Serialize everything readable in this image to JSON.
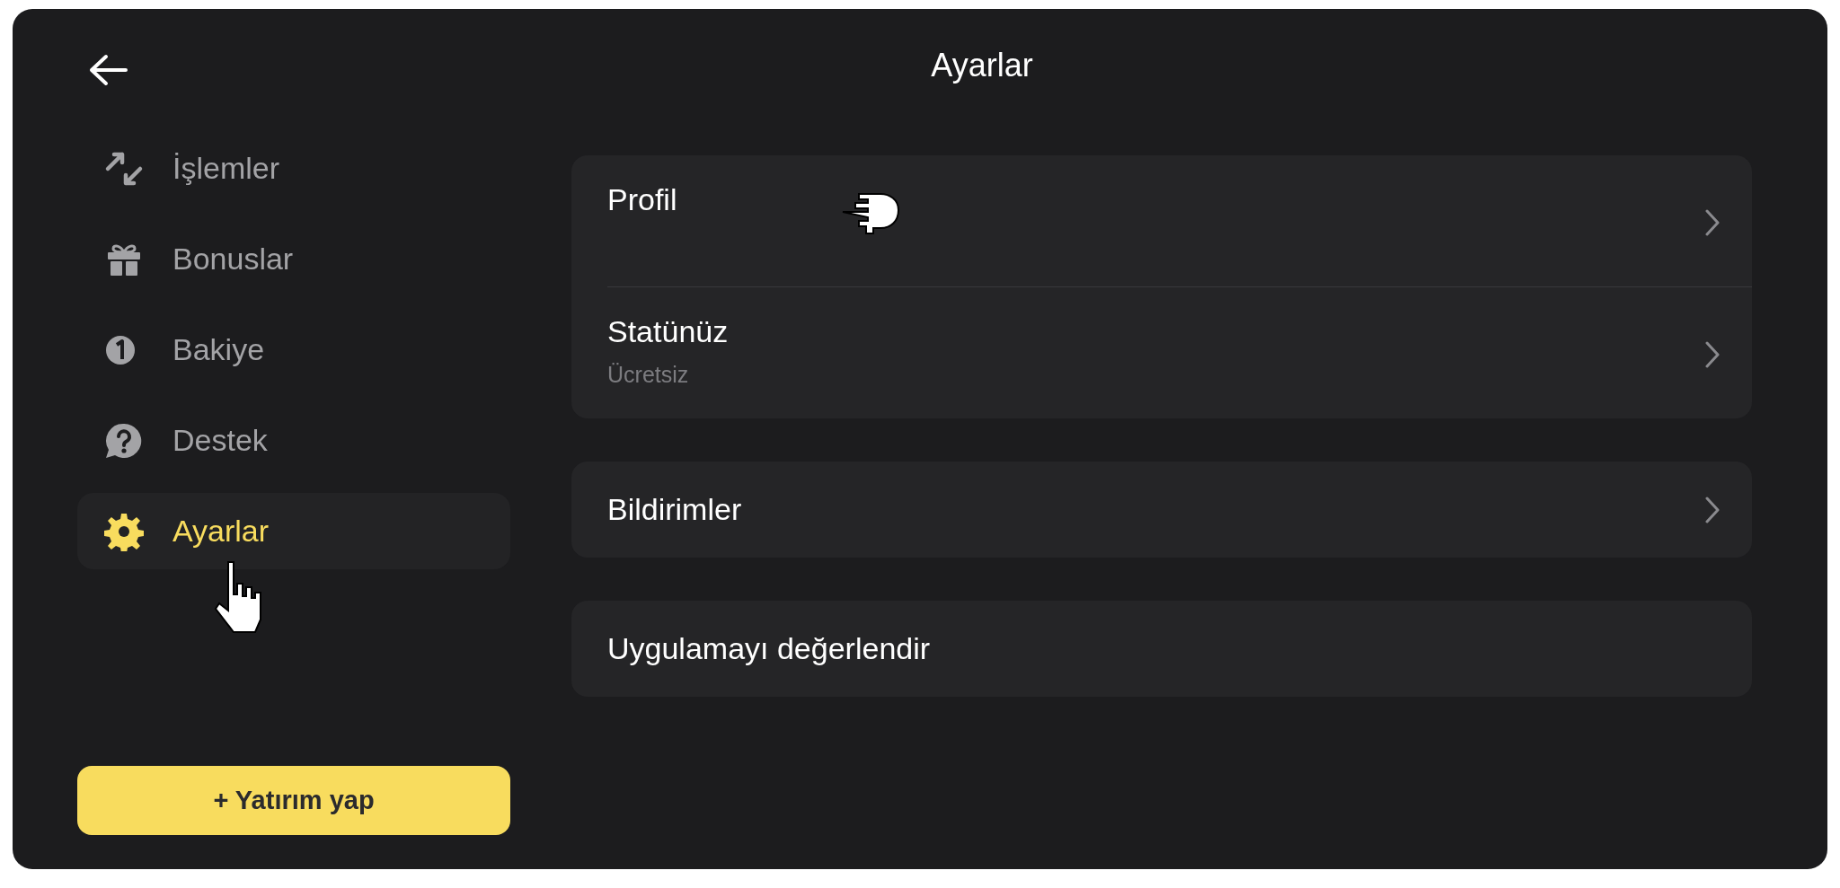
{
  "header": {
    "title": "Ayarlar"
  },
  "sidebar": {
    "items": [
      {
        "label": "İşlemler",
        "selected": false
      },
      {
        "label": "Bonuslar",
        "selected": false
      },
      {
        "label": "Bakiye",
        "selected": false
      },
      {
        "label": "Destek",
        "selected": false
      },
      {
        "label": "Ayarlar",
        "selected": true
      }
    ],
    "button": "+ Yatırım yap"
  },
  "groups": [
    {
      "rows": [
        {
          "kind": "chevron",
          "title": "Profil"
        },
        {
          "kind": "chevron",
          "title": "Statünüz",
          "subtitle": "Ücretsiz"
        }
      ]
    },
    {
      "rows": [
        {
          "kind": "chevron",
          "title": "Bildirimler"
        }
      ]
    },
    {
      "rows": [
        {
          "kind": "plain",
          "title": "Uygulamayı değerlendir"
        }
      ]
    }
  ]
}
